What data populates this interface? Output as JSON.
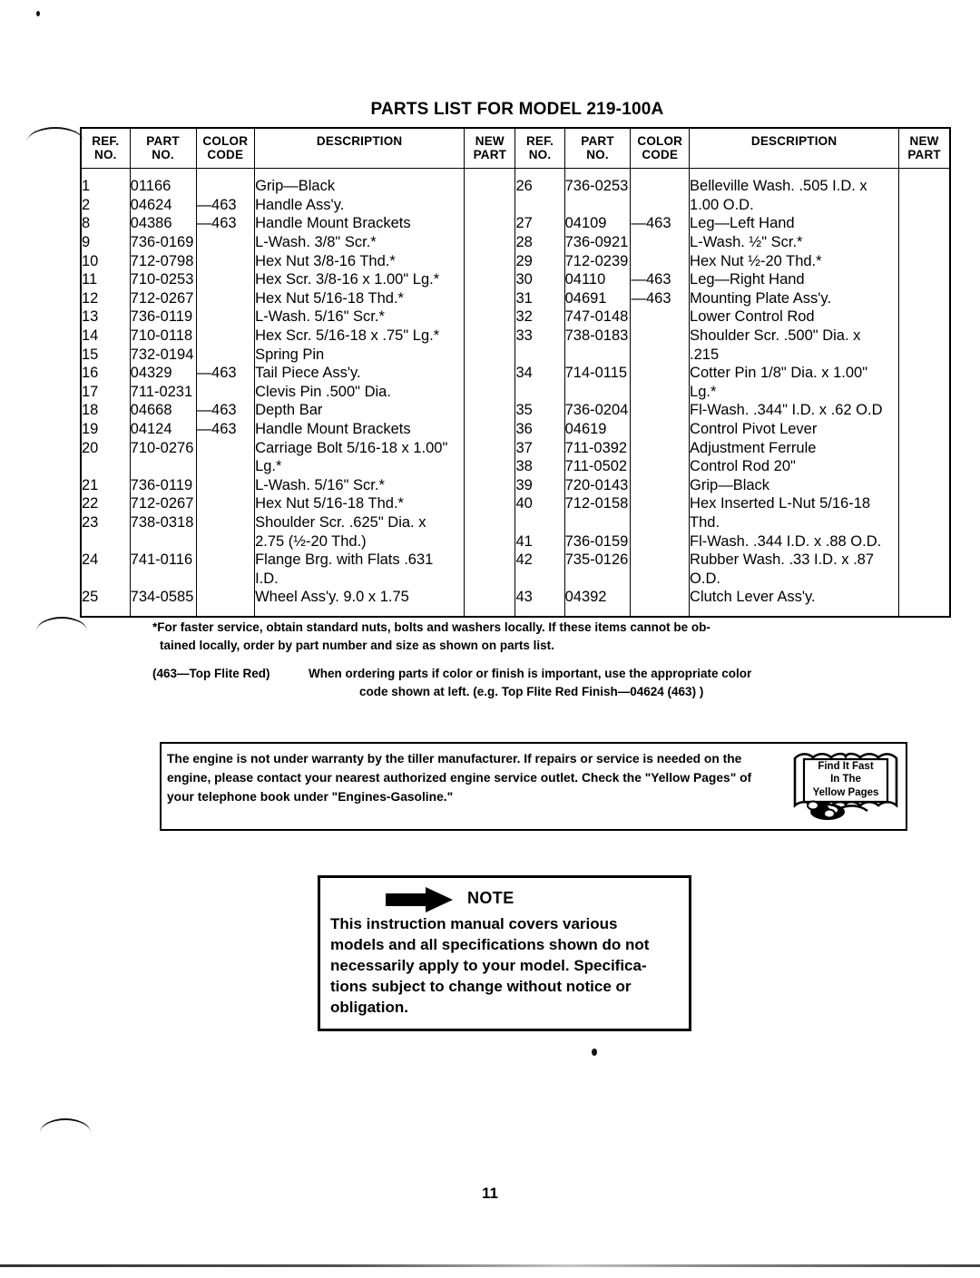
{
  "title": "PARTS LIST FOR MODEL 219-100A",
  "page_number": "11",
  "table": {
    "headers": {
      "ref_no": "REF.\nNO.",
      "ref_no_l1": "REF.",
      "ref_no_l2": "NO.",
      "part_no_l1": "PART",
      "part_no_l2": "NO.",
      "color_code_l1": "COLOR",
      "color_code_l2": "CODE",
      "description": "DESCRIPTION",
      "new_part_l1": "NEW",
      "new_part_l2": "PART"
    },
    "left_rows": [
      {
        "ref": "1",
        "part": "01166",
        "color": "",
        "desc": [
          "Grip—Black"
        ]
      },
      {
        "ref": "2",
        "part": "04624",
        "color": "—463",
        "desc": [
          "Handle Ass'y."
        ]
      },
      {
        "ref": "8",
        "part": "04386",
        "color": "—463",
        "desc": [
          "Handle Mount Brackets"
        ]
      },
      {
        "ref": "9",
        "part": "736-0169",
        "color": "",
        "desc": [
          "L-Wash. 3/8\" Scr.*"
        ]
      },
      {
        "ref": "10",
        "part": "712-0798",
        "color": "",
        "desc": [
          "Hex Nut 3/8-16 Thd.*"
        ]
      },
      {
        "ref": "11",
        "part": "710-0253",
        "color": "",
        "desc": [
          "Hex Scr. 3/8-16 x 1.00\" Lg.*"
        ]
      },
      {
        "ref": "12",
        "part": "712-0267",
        "color": "",
        "desc": [
          "Hex Nut 5/16-18 Thd.*"
        ]
      },
      {
        "ref": "13",
        "part": "736-0119",
        "color": "",
        "desc": [
          "L-Wash. 5/16\" Scr.*"
        ]
      },
      {
        "ref": "14",
        "part": "710-0118",
        "color": "",
        "desc": [
          "Hex Scr. 5/16-18 x .75\" Lg.*"
        ]
      },
      {
        "ref": "15",
        "part": "732-0194",
        "color": "",
        "desc": [
          "Spring Pin"
        ]
      },
      {
        "ref": "16",
        "part": "04329",
        "color": "—463",
        "desc": [
          "Tail Piece Ass'y."
        ]
      },
      {
        "ref": "17",
        "part": "711-0231",
        "color": "",
        "desc": [
          "Clevis Pin .500\" Dia."
        ]
      },
      {
        "ref": "18",
        "part": "04668",
        "color": "—463",
        "desc": [
          "Depth Bar"
        ]
      },
      {
        "ref": "19",
        "part": "04124",
        "color": "—463",
        "desc": [
          "Handle Mount Brackets"
        ]
      },
      {
        "ref": "20",
        "part": "710-0276",
        "color": "",
        "desc": [
          "Carriage Bolt 5/16-18 x 1.00\"",
          "Lg.*"
        ]
      },
      {
        "ref": "21",
        "part": "736-0119",
        "color": "",
        "desc": [
          "L-Wash. 5/16\" Scr.*"
        ]
      },
      {
        "ref": "22",
        "part": "712-0267",
        "color": "",
        "desc": [
          "Hex Nut 5/16-18 Thd.*"
        ]
      },
      {
        "ref": "23",
        "part": "738-0318",
        "color": "",
        "desc": [
          "Shoulder Scr. .625\" Dia. x",
          "2.75 (½-20 Thd.)"
        ]
      },
      {
        "ref": "24",
        "part": "741-0116",
        "color": "",
        "desc": [
          "Flange Brg. with Flats .631",
          "I.D."
        ]
      },
      {
        "ref": "25",
        "part": "734-0585",
        "color": "",
        "desc": [
          "Wheel Ass'y. 9.0 x 1.75"
        ]
      }
    ],
    "right_rows": [
      {
        "ref": "26",
        "part": "736-0253",
        "color": "",
        "desc": [
          "Belleville Wash. .505 I.D. x",
          "1.00 O.D."
        ]
      },
      {
        "ref": "27",
        "part": "04109",
        "color": "—463",
        "desc": [
          "Leg—Left Hand"
        ]
      },
      {
        "ref": "28",
        "part": "736-0921",
        "color": "",
        "desc": [
          "L-Wash. ½\" Scr.*"
        ]
      },
      {
        "ref": "29",
        "part": "712-0239",
        "color": "",
        "desc": [
          "Hex Nut ½-20 Thd.*"
        ]
      },
      {
        "ref": "30",
        "part": "04110",
        "color": "—463",
        "desc": [
          "Leg—Right Hand"
        ]
      },
      {
        "ref": "31",
        "part": "04691",
        "color": "—463",
        "desc": [
          "Mounting Plate Ass'y."
        ]
      },
      {
        "ref": "32",
        "part": "747-0148",
        "color": "",
        "desc": [
          "Lower Control Rod"
        ]
      },
      {
        "ref": "33",
        "part": "738-0183",
        "color": "",
        "desc": [
          "Shoulder Scr. .500\" Dia. x",
          ".215"
        ]
      },
      {
        "ref": "34",
        "part": "714-0115",
        "color": "",
        "desc": [
          "Cotter Pin 1/8\" Dia. x 1.00\"",
          "Lg.*"
        ]
      },
      {
        "ref": "35",
        "part": "736-0204",
        "color": "",
        "desc": [
          "Fl-Wash. .344\" I.D. x .62 O.D"
        ]
      },
      {
        "ref": "36",
        "part": "04619",
        "color": "",
        "desc": [
          "Control Pivot Lever"
        ]
      },
      {
        "ref": "37",
        "part": "711-0392",
        "color": "",
        "desc": [
          "Adjustment Ferrule"
        ]
      },
      {
        "ref": "38",
        "part": "711-0502",
        "color": "",
        "desc": [
          "Control Rod 20\""
        ]
      },
      {
        "ref": "39",
        "part": "720-0143",
        "color": "",
        "desc": [
          "Grip—Black"
        ]
      },
      {
        "ref": "40",
        "part": "712-0158",
        "color": "",
        "desc": [
          "Hex Inserted L-Nut 5/16-18",
          "Thd."
        ]
      },
      {
        "ref": "41",
        "part": "736-0159",
        "color": "",
        "desc": [
          "Fl-Wash. .344 I.D. x .88 O.D."
        ]
      },
      {
        "ref": "42",
        "part": "735-0126",
        "color": "",
        "desc": [
          "Rubber Wash. .33 I.D. x .87",
          "O.D."
        ]
      },
      {
        "ref": "43",
        "part": "04392",
        "color": "",
        "desc": [
          "Clutch Lever Ass'y."
        ]
      }
    ]
  },
  "footnotes": {
    "star_line1": "*For faster service, obtain standard nuts, bolts and washers locally. If these items cannot be ob-",
    "star_line2": "tained locally, order by part number and size as shown on parts list.",
    "color_label": "(463—Top Flite Red)",
    "color_line1": "When ordering parts if color or finish is important, use the appropriate color",
    "color_line2": "code shown at left. (e.g. Top Flite Red Finish—04624 (463) )"
  },
  "warranty": {
    "line1": "The engine is not under warranty by the tiller manufacturer. If repairs or service is needed on the",
    "line2": "engine, please contact your nearest authorized engine service outlet. Check the \"Yellow Pages\" of",
    "line3": "your telephone book under \"Engines-Gasoline.\"",
    "logo_line1": "Find It Fast",
    "logo_line2": "In The",
    "logo_line3": "Yellow Pages"
  },
  "note": {
    "label": "NOTE",
    "line1": "This instruction manual covers various",
    "line2": "models and all specifications shown do not",
    "line3": "necessarily apply to your model. Specifica-",
    "line4": "tions subject to change without notice or",
    "line5": "obligation."
  }
}
